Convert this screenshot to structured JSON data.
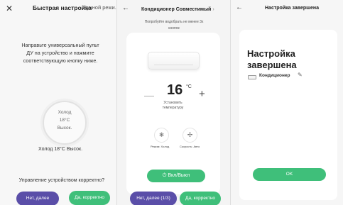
{
  "panel1": {
    "close_icon": "close-icon",
    "title": "Быстрая настройка",
    "subtitle": "Ручной режи...",
    "instruction_lines": [
      "Направьте универсальный пульт",
      "ДУ на устройство и нажмите",
      "соответствующую кнопку ниже."
    ],
    "circle_lines": [
      "Холод",
      "18°C",
      "Высок."
    ],
    "caption": "Холод 18°C Высок.",
    "question": "Управление устройством корректно?",
    "no_button": "Нет, далее",
    "yes_button": "Да, корректно"
  },
  "panel2": {
    "back_icon": "back-arrow-icon",
    "title": "Кондиционер Совместимый",
    "title_chevron": "›",
    "hint_lines": [
      "Попробуйте водобрать не менее 3х",
      "кнопок"
    ],
    "minus": "—",
    "temperature": "16",
    "unit": "°C",
    "plus": "+",
    "set_label_lines": [
      "Установить",
      "температуру"
    ],
    "mode_icon": "❄",
    "fan_icon": "✢",
    "mode_label": "Режим: Холод",
    "fan_label": "Скорость: Авто",
    "power_icon": "⏻",
    "power_label": "Вкл/Выкл",
    "no_button": "Нет, далее (1/3)",
    "yes_button": "Да, корректно"
  },
  "panel3": {
    "back_icon": "back-arrow-icon",
    "title": "Настройка завершена",
    "heading_lines": [
      "Настройка",
      "завершена"
    ],
    "device_name": "Кондиционер",
    "edit_icon": "✎",
    "ok_button": "OK"
  },
  "colors": {
    "primary_green": "#3fbf7a",
    "secondary_purple": "#5a4ea8"
  }
}
